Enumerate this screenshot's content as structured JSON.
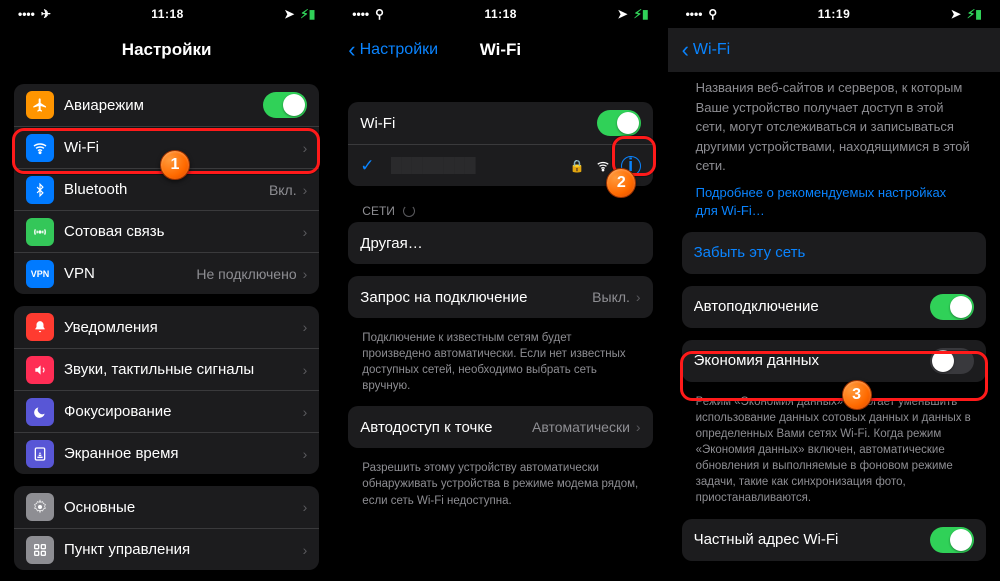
{
  "statusbar": {
    "time": "11:18",
    "time3": "11:19"
  },
  "screen1": {
    "title": "Настройки",
    "rows": {
      "airplane": "Авиарежим",
      "wifi": "Wi-Fi",
      "bluetooth": "Bluetooth",
      "bluetooth_val": "Вкл.",
      "cellular": "Сотовая связь",
      "hotspot": "VPN",
      "hotspot_val": "Не подключено",
      "notifications": "Уведомления",
      "sounds": "Звуки, тактильные сигналы",
      "focus": "Фокусирование",
      "screentime": "Экранное время",
      "general": "Основные",
      "control": "Пункт управления"
    }
  },
  "screen2": {
    "back": "Настройки",
    "title": "Wi-Fi",
    "wifi_label": "Wi-Fi",
    "networks_label": "СЕТИ",
    "other": "Другая…",
    "ask_join": "Запрос на подключение",
    "ask_join_val": "Выкл.",
    "ask_join_foot": "Подключение к известным сетям будет произведено автоматически. Если нет известных доступных сетей, необходимо выбрать сеть вручную.",
    "auto_hotspot": "Автодоступ к точке",
    "auto_hotspot_val": "Автоматически",
    "auto_hotspot_foot": "Разрешить этому устройству автоматически обнаруживать устройства в режиме модема рядом, если сеть Wi-Fi недоступна."
  },
  "screen3": {
    "back": "Wi-Fi",
    "desc": "Названия веб-сайтов и серверов, к которым Ваше устройство получает доступ в этой сети, могут отслеживаться и записываться другими устройствами, находящимися в этой сети.",
    "more_link": "Подробнее о рекомендуемых настройках для Wi-Fi…",
    "forget": "Забыть эту сеть",
    "autojoin": "Автоподключение",
    "lowdata": "Экономия данных",
    "lowdata_foot": "Режим «Экономия данных» помогает уменьшить использование данных сотовых данных и данных в определенных Вами сетях Wi-Fi. Когда режим «Экономия данных» включен, автоматические обновления и выполняемые в фоновом режиме задачи, такие как синхронизация фото, приостанавливаются.",
    "private": "Частный адрес Wi-Fi"
  },
  "badges": {
    "b1": "1",
    "b2": "2",
    "b3": "3"
  }
}
